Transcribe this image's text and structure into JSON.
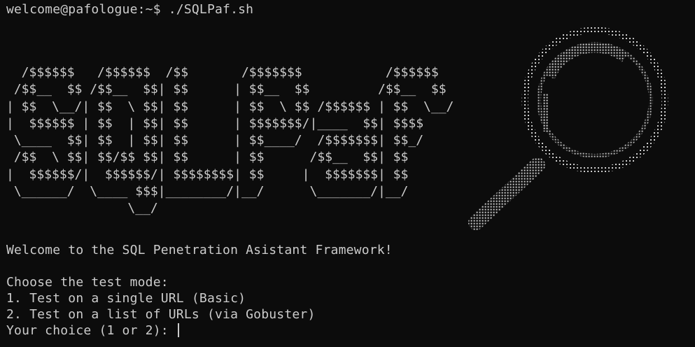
{
  "terminal": {
    "prompt": "welcome@pafologue:~$ ./SQLPaf.sh",
    "banner_lines": [
      "  /$$$$$$   /$$$$$$  /$$       /$$$$$$$           /$$$$$$",
      " /$$__  $$ /$$__  $$| $$      | $$__  $$         /$$__  $$",
      "| $$  \\__/| $$  \\ $$| $$      | $$  \\ $$ /$$$$$$ | $$  \\__/",
      "|  $$$$$$ | $$  | $$| $$      | $$$$$$$/|____  $$| $$$$",
      " \\____  $$| $$  | $$| $$      | $$____/  /$$$$$$$| $$_/",
      " /$$  \\ $$| $$/$$ $$| $$      | $$      /$$__  $$| $$",
      "|  $$$$$$/|  $$$$$$/| $$$$$$$$| $$     |  $$$$$$$| $$",
      " \\______/  \\____ $$$|________/|__/      \\_______/|__/",
      "                \\__/"
    ],
    "welcome": "Welcome to the SQL Penetration Asistant Framework!",
    "choose_mode": "Choose the test mode:",
    "option_1": "1. Test on a single URL (Basic)",
    "option_2": "2. Test on a list of URLs (via Gobuster)",
    "input_prompt": "Your choice (1 or 2): "
  },
  "colors": {
    "background": "#0c0c0c",
    "foreground": "#cccccc"
  },
  "icons": [
    "magnifying-glass-ascii-art-icon"
  ]
}
